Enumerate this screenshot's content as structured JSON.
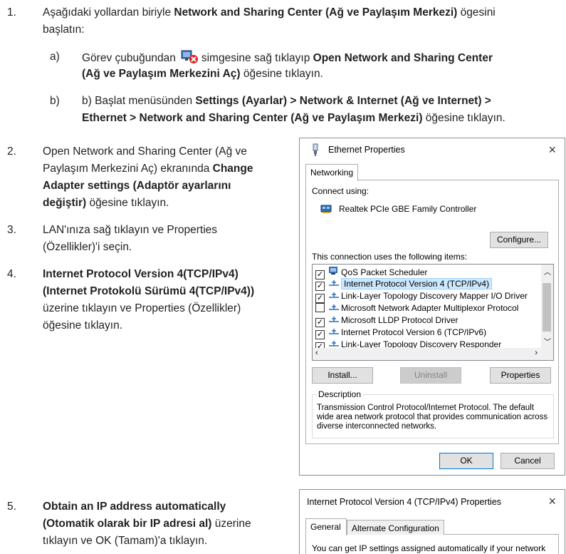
{
  "steps": {
    "s1": {
      "number": "1.",
      "line1_a": "Aşağıdaki yollardan biriyle ",
      "line1_b": "Network and Sharing Center (Ağ ve Paylaşım Merkezi)",
      "line1_c": " ögesini",
      "line2": "başlatın:"
    },
    "s1a": {
      "letter": "a)",
      "text_a": "Görev çubuğundan",
      "text_b": "simgesine sağ tıklayıp ",
      "text_c": "Open Network and Sharing Center",
      "text_d": "(Ağ ve Paylaşım Merkezini Aç)",
      "text_e": " öğesine tıklayın."
    },
    "s1b": {
      "letter": "b)",
      "text_a": "b) Başlat menüsünden ",
      "text_b": "Settings (Ayarlar) > Network & Internet (Ağ ve Internet) >",
      "text_c": "Ethernet > Network and Sharing Center (Ağ ve Paylaşım Merkezi)",
      "text_d": " öğesine tıklayın."
    },
    "s2": {
      "number": "2.",
      "line1": "Open Network and Sharing Center (Ağ ve",
      "line2_a": "Paylaşım Merkezini Aç) ekranında ",
      "line2_b": "Change",
      "line3": "Adapter settings (Adaptör ayarlarını",
      "line4_a": "değiştir)",
      "line4_b": " öğesine tıklayın."
    },
    "s3": {
      "number": "3.",
      "line1": "LAN'ınıza sağ tıklayın ve Properties",
      "line2": "(Özellikler)'i seçin."
    },
    "s4": {
      "number": "4.",
      "line1": "Internet Protocol Version 4(TCP/IPv4)",
      "line2": "(Internet Protokolü Sürümü 4(TCP/IPv4))",
      "line3": "üzerine tıklayın ve Properties (Özellikler)",
      "line4": "öğesine tıklayın."
    },
    "s5": {
      "number": "5.",
      "line1": "Obtain an IP address automatically",
      "line2_a": "(Otomatik olarak bir IP adresi al)",
      "line2_b": " üzerine",
      "line3": "tıklayın ve OK (Tamam)'a tıklayın."
    }
  },
  "ethernet_dialog": {
    "title": "Ethernet Properties",
    "close": "×",
    "tab": "Networking",
    "connect_using_label": "Connect using:",
    "adapter_name": "Realtek PCIe GBE Family Controller",
    "configure_button": "Configure...",
    "items_label": "This connection uses the following items:",
    "items": [
      {
        "label": "QoS Packet Scheduler",
        "checked": true
      },
      {
        "label": "Internet Protocol Version 4 (TCP/IPv4)",
        "checked": true,
        "selected": true
      },
      {
        "label": "Link-Layer Topology Discovery Mapper I/O Driver",
        "checked": true
      },
      {
        "label": "Microsoft Network Adapter Multiplexor Protocol",
        "checked": false
      },
      {
        "label": "Microsoft LLDP Protocol Driver",
        "checked": true
      },
      {
        "label": "Internet Protocol Version 6 (TCP/IPv6)",
        "checked": true
      },
      {
        "label": "Link-Layer Topology Discovery Responder",
        "checked": true
      }
    ],
    "install_button": "Install...",
    "uninstall_button": "Uninstall",
    "properties_button": "Properties",
    "description_label": "Description",
    "description_text": "Transmission Control Protocol/Internet Protocol. The default wide area network protocol that provides communication across diverse interconnected networks.",
    "ok_button": "OK",
    "cancel_button": "Cancel"
  },
  "ipv4_dialog": {
    "title": "Internet Protocol Version 4 (TCP/IPv4) Properties",
    "close": "×",
    "tab_general": "General",
    "tab_alternate": "Alternate Configuration",
    "partial_text": "You can get IP settings assigned automatically if your network supports"
  },
  "colors": {
    "text": "#231f20",
    "selection": "#cce8ff",
    "dialog_border": "#8c8c8c"
  }
}
